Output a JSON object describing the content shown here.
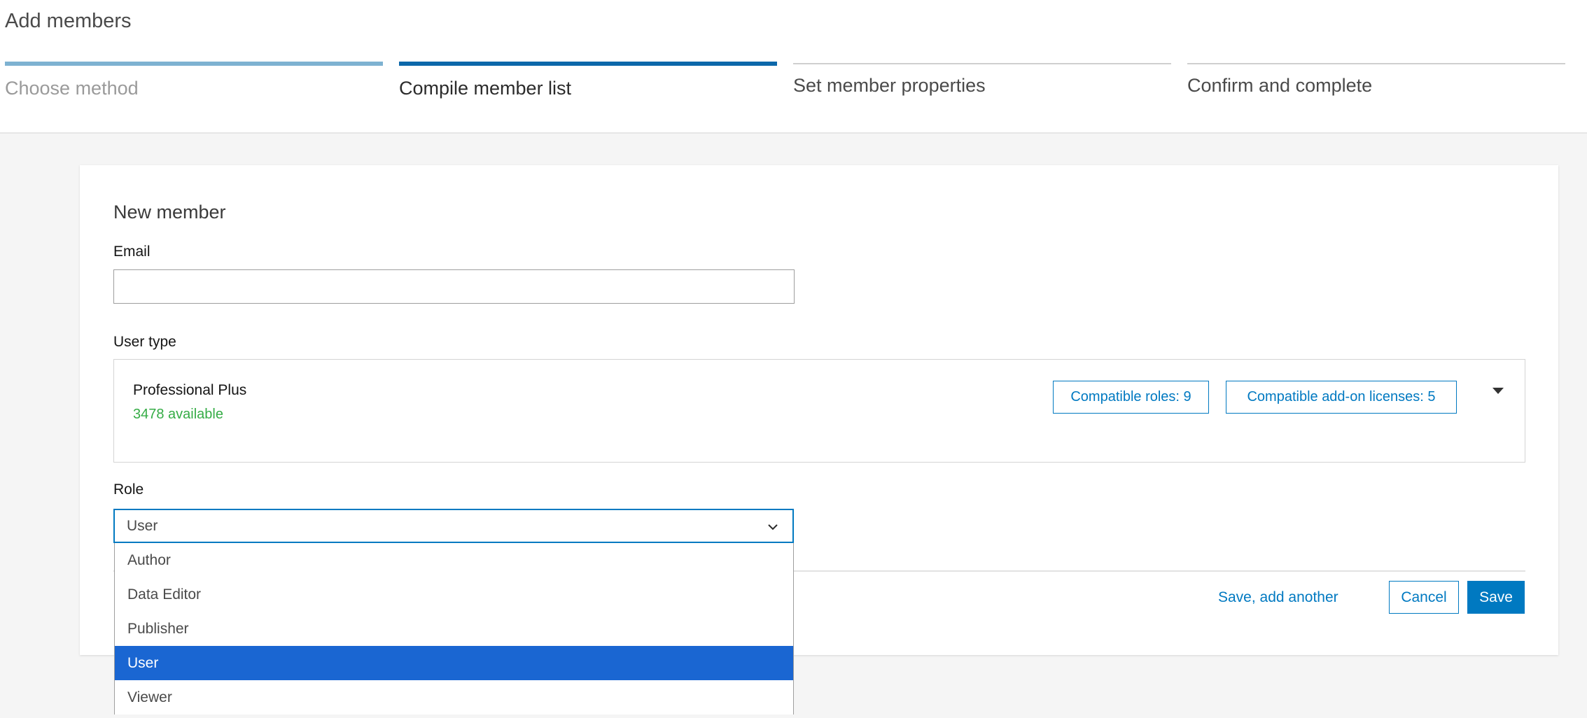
{
  "header": {
    "title": "Add members",
    "steps": [
      {
        "label": "Choose method",
        "state": "done"
      },
      {
        "label": "Compile member list",
        "state": "active"
      },
      {
        "label": "Set member properties",
        "state": "pending"
      },
      {
        "label": "Confirm and complete",
        "state": "pending"
      }
    ]
  },
  "form": {
    "title": "New member",
    "email": {
      "label": "Email",
      "value": "",
      "placeholder": ""
    },
    "user_type": {
      "label": "User type",
      "name": "Professional Plus",
      "available": "3478 available",
      "compatible_roles": "Compatible roles: 9",
      "compatible_addons": "Compatible add-on licenses: 5"
    },
    "role": {
      "label": "Role",
      "selected": "User",
      "options": [
        "Author",
        "Data Editor",
        "Publisher",
        "User",
        "Viewer"
      ]
    },
    "actions": {
      "save_add_another": "Save, add another",
      "cancel": "Cancel",
      "save": "Save"
    }
  },
  "colors": {
    "accent": "#0079c1",
    "step_active": "#0c68aa",
    "step_done": "#7eb2d1",
    "available": "#35ac46",
    "option_selected": "#1a66d2"
  }
}
